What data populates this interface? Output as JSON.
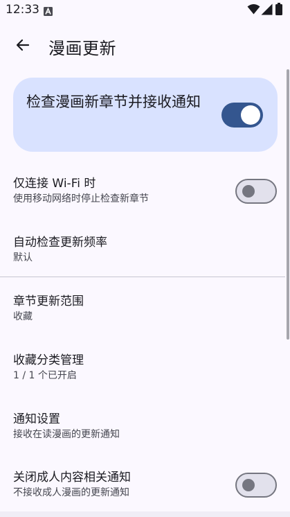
{
  "status_bar": {
    "time": "12:33",
    "icons": [
      "a-notification-icon",
      "wifi-icon",
      "signal-icon",
      "battery-icon"
    ]
  },
  "top_bar": {
    "back_icon": "arrow-left-icon",
    "title": "漫画更新"
  },
  "master_toggle": {
    "label": "检查漫画新章节并接收通知",
    "checked": true
  },
  "preferences": [
    {
      "id": "wifi-only",
      "title": "仅连接 Wi-Fi 时",
      "summary": "使用移动网络时停止检查新章节",
      "type": "switch",
      "checked": false
    },
    {
      "id": "frequency",
      "title": "自动检查更新频率",
      "summary": "默认",
      "type": "list"
    },
    {
      "id": "scope",
      "title": "章节更新范围",
      "summary": "收藏",
      "type": "list"
    },
    {
      "id": "categories",
      "title": "收藏分类管理",
      "summary": "1 / 1 个已开启",
      "type": "list"
    },
    {
      "id": "notifications",
      "title": "通知设置",
      "summary": "接收在读漫画的更新通知",
      "type": "link"
    },
    {
      "id": "nsfw",
      "title": "关闭成人内容相关通知",
      "summary": "不接收成人漫画的更新通知",
      "type": "switch",
      "checked": false
    }
  ],
  "colors": {
    "background": "#fbf8ff",
    "master_card": "#d9e2ff",
    "switch_on": "#34568f",
    "switch_off_track": "#e2e1ec",
    "switch_off_outline": "#757680"
  }
}
